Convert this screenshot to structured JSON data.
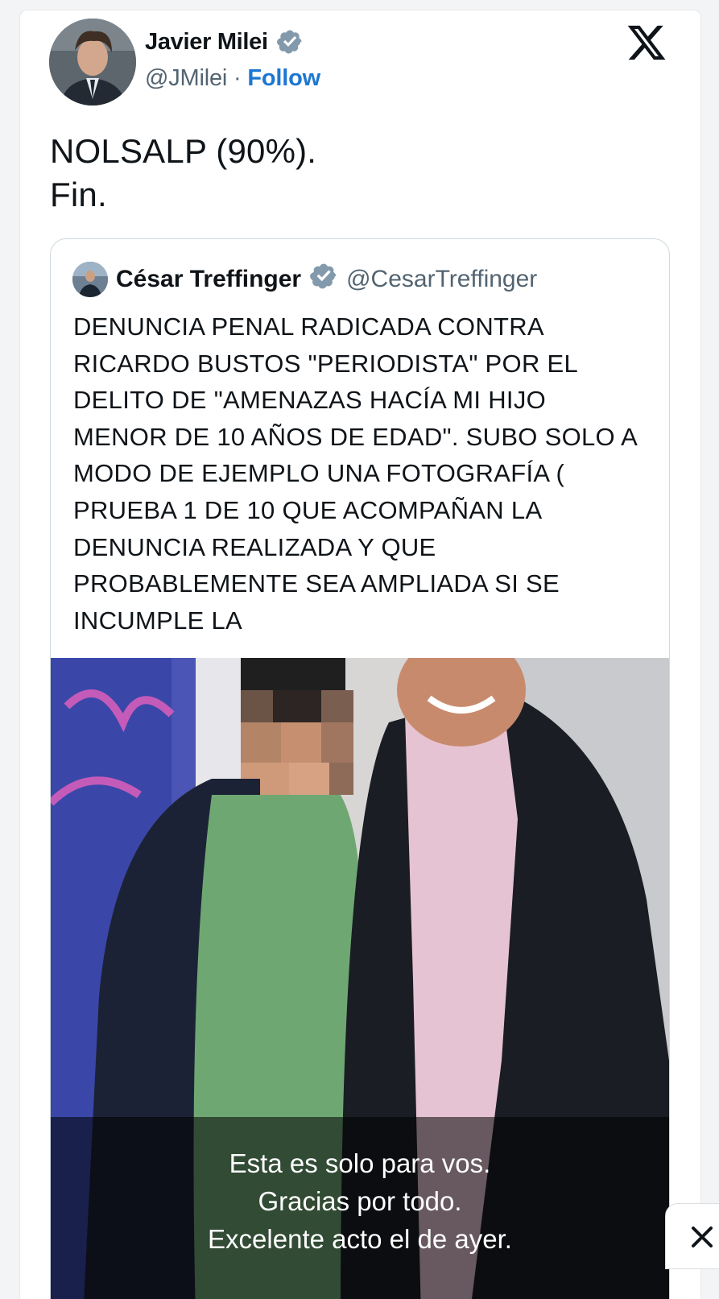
{
  "author": {
    "name": "Javier Milei",
    "handle": "@JMilei",
    "separator": "·",
    "follow_label": "Follow"
  },
  "tweet": {
    "lines": [
      "NOLSALP (90%).",
      "Fin."
    ]
  },
  "quoted": {
    "name": "César Treffinger",
    "handle": "@CesarTreffinger",
    "text_lines": [
      "DENUNCIA PENAL RADICADA CONTRA",
      "RICARDO BUSTOS \"PERIODISTA\" POR EL",
      "DELITO DE \"AMENAZAS HACÍA MI HIJO",
      "MENOR DE 10 AÑOS DE EDAD\". SUBO SOLO A",
      "MODO DE EJEMPLO UNA FOTOGRAFÍA (",
      "PRUEBA 1 DE 10 QUE ACOMPAÑAN LA",
      "DENUNCIA REALIZADA Y QUE",
      "PROBABLEMENTE SEA AMPLIADA SI SE",
      "INCUMPLE LA"
    ],
    "photo_caption": [
      "Esta es solo para vos.",
      "Gracias por todo.",
      "Excelente acto el de ayer."
    ]
  },
  "icons": {
    "verified": "verified-badge-icon",
    "platform": "x-logo-icon",
    "close": "close-icon"
  },
  "colors": {
    "follow": "#1d77d2",
    "verified": "#829aab",
    "text": "#0f1419",
    "muted": "#536471"
  }
}
